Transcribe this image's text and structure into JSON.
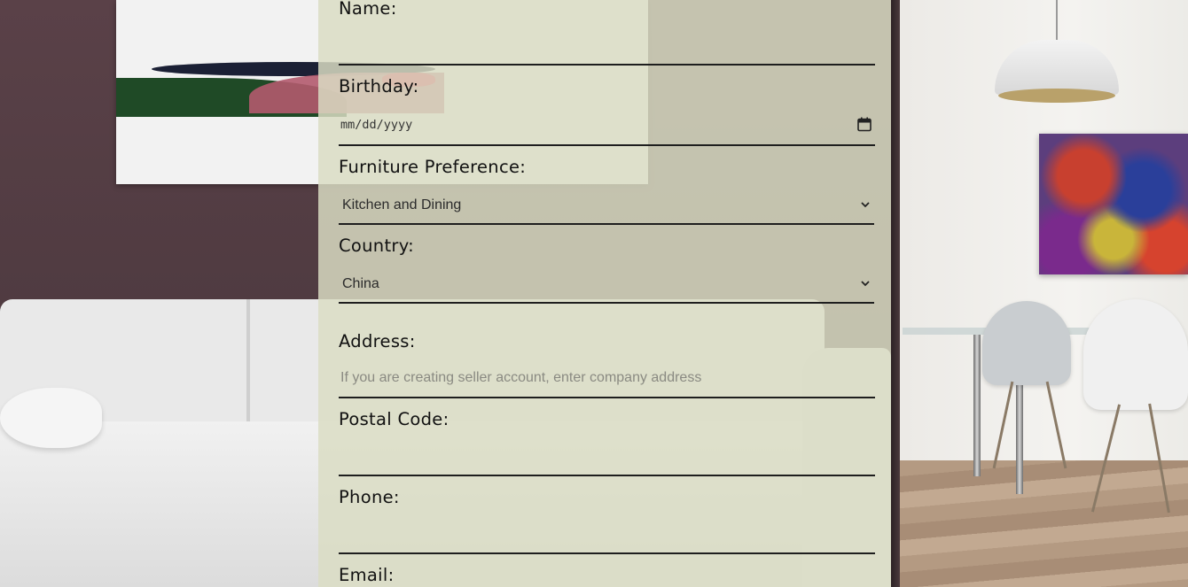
{
  "form": {
    "name": {
      "label": "Name:",
      "value": ""
    },
    "birthday": {
      "label": "Birthday:",
      "placeholder": "mm/dd/yyyy"
    },
    "furniture": {
      "label": "Furniture Preference:",
      "selected": "Kitchen and Dining"
    },
    "country": {
      "label": "Country:",
      "selected": "China"
    },
    "address": {
      "label": "Address:",
      "placeholder": "If you are creating seller account, enter company address"
    },
    "postal": {
      "label": "Postal Code:",
      "value": ""
    },
    "phone": {
      "label": "Phone:",
      "value": ""
    },
    "email": {
      "label": "Email:"
    }
  },
  "icons": {
    "calendar": "calendar-icon",
    "dropdown": "chevron-down-icon"
  },
  "colors": {
    "panel_overlay": "#dadcc4",
    "underline": "#1e1e1e",
    "label_text": "#111111"
  }
}
